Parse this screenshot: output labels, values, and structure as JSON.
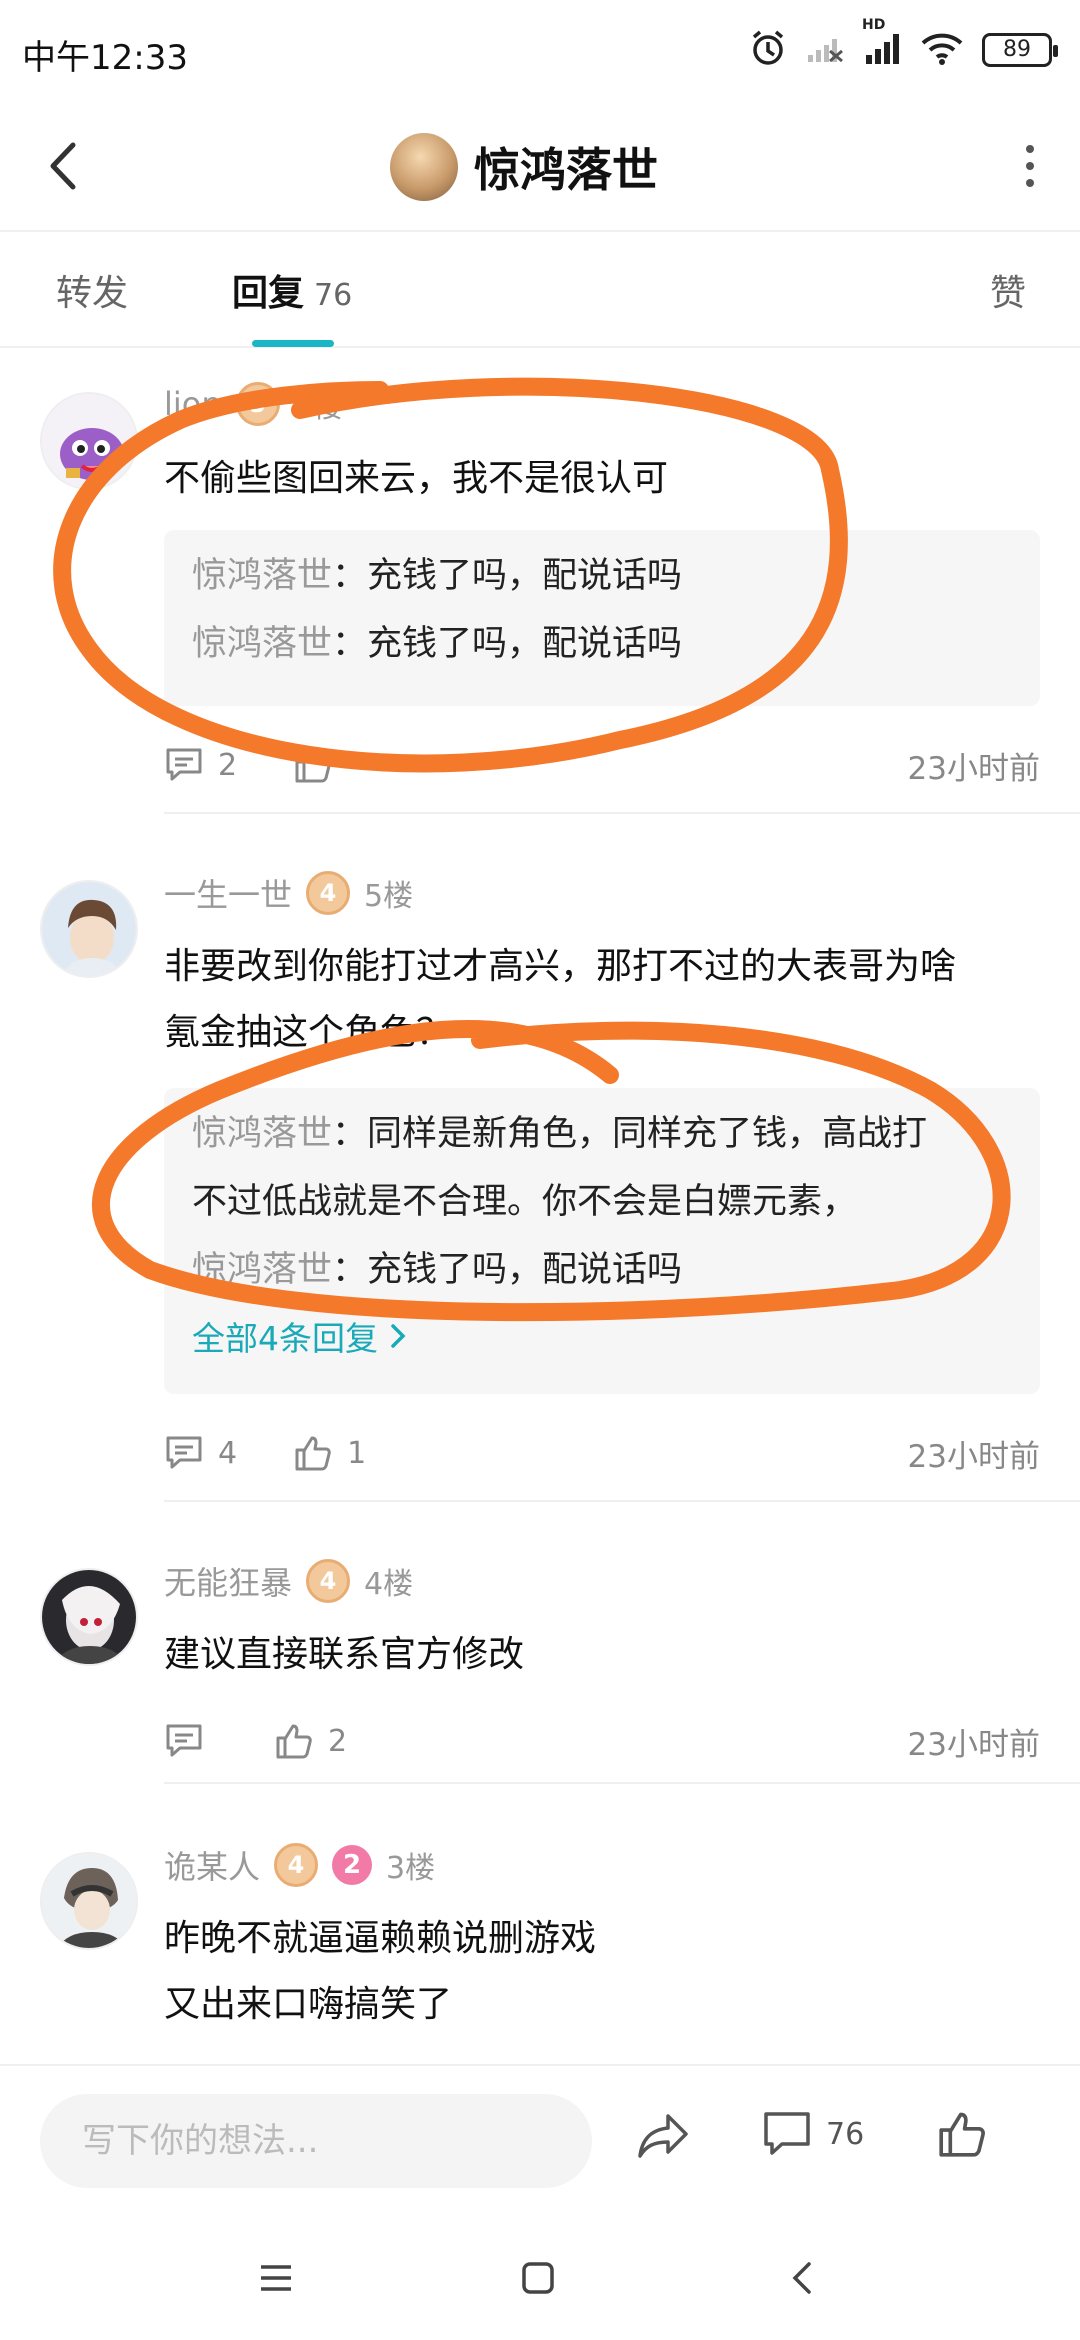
{
  "status": {
    "time": "中午12:33",
    "battery": "89",
    "network": "HD"
  },
  "header": {
    "title": "惊鸿落世"
  },
  "tabs": {
    "forward": "转发",
    "reply": "回复",
    "reply_count": "76",
    "like": "赞"
  },
  "comments": [
    {
      "name": "lion",
      "level": "5",
      "floor": "6楼",
      "text": "不偷些图回来云，我不是很认可",
      "replies": [
        {
          "author": "惊鸿落世",
          "text": "：充钱了吗，配说话吗"
        },
        {
          "author": "惊鸿落世",
          "text": "：充钱了吗，配说话吗"
        }
      ],
      "comment_count": "2",
      "like_count": "",
      "time": "23小时前"
    },
    {
      "name": "一生一世",
      "level": "4",
      "floor": "5楼",
      "text_lines": [
        "非要改到你能打过才高兴，那打不过的大表哥为啥",
        "氪金抽这个角色？"
      ],
      "replies": [
        {
          "author": "惊鸿落世",
          "text": "：同样是新角色，同样充了钱，高战打"
        },
        {
          "author": "",
          "text": "不过低战就是不合理。你不会是白嫖元素，"
        },
        {
          "author": "惊鸿落世",
          "text": "：充钱了吗，配说话吗"
        }
      ],
      "all_replies": "全部4条回复",
      "comment_count": "4",
      "like_count": "1",
      "time": "23小时前"
    },
    {
      "name": "无能狂暴",
      "level": "4",
      "floor": "4楼",
      "text": "建议直接联系官方修改",
      "comment_count": "",
      "like_count": "2",
      "time": "23小时前"
    },
    {
      "name": "诡某人",
      "level": "4",
      "vip": "2",
      "floor": "3楼",
      "text_lines": [
        "昨晚不就逼逼赖赖说删游戏",
        "又出来口嗨搞笑了"
      ]
    }
  ],
  "bottom": {
    "placeholder": "写下你的想法...",
    "comment_count": "76"
  },
  "colors": {
    "accent": "#19b6c6",
    "annotation": "#f5792a"
  }
}
